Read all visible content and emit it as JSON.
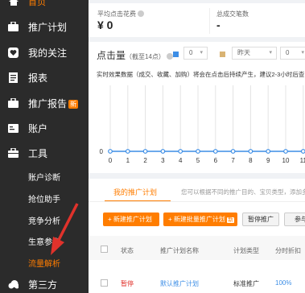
{
  "sidebar": {
    "items": [
      {
        "label": "首页"
      },
      {
        "label": "推广计划"
      },
      {
        "label": "我的关注"
      },
      {
        "label": "报表"
      },
      {
        "label": "推广报告",
        "badge": "新"
      },
      {
        "label": "账户"
      },
      {
        "label": "工具"
      },
      {
        "label": "第三方"
      }
    ],
    "tool_subitems": [
      "账户诊断",
      "抢位助手",
      "竞争分析",
      "生意参谋",
      "流量解析"
    ],
    "active_subitem": "流量解析"
  },
  "stats": [
    {
      "label": "平均点击花费",
      "value": "¥ 0"
    },
    {
      "label": "总成交笔数",
      "value": "-"
    }
  ],
  "chart": {
    "title": "点击量",
    "title_note": "（截至14点）",
    "metric_select": "0",
    "compare_select": "昨天",
    "compare_select_2": "0",
    "note": "实时效果数据（成交、收藏、加购）将会在点击后持续产生，建议2-3小时后查",
    "accent_colors": {
      "today": "#3d8ee6",
      "compare": "#d9b373"
    }
  },
  "chart_data": {
    "type": "line",
    "x": [
      0,
      1,
      2,
      3,
      4,
      5,
      6,
      7,
      8,
      9,
      10,
      11
    ],
    "series": [
      {
        "values": [
          0,
          0,
          0,
          0,
          0,
          0,
          0,
          0,
          0,
          0,
          0,
          0
        ]
      }
    ],
    "ytick": "0",
    "grid": true
  },
  "plans": {
    "tab_active": "我的推广计划",
    "tab_hint": "您可以根据不同的推广目的、宝贝类型，添加多",
    "buttons": {
      "new_plan": "新建推广计划",
      "bulk_new": "新建批量推广计划",
      "bulk_badge": "新",
      "pause": "暂停推广",
      "more": "参与"
    },
    "columns": [
      "状态",
      "推广计划名称",
      "计划类型",
      "分时折扣"
    ],
    "rows": [
      {
        "status": "暂停",
        "name": "默认推广计划",
        "type": "标准推广",
        "discount": "100%"
      }
    ]
  }
}
